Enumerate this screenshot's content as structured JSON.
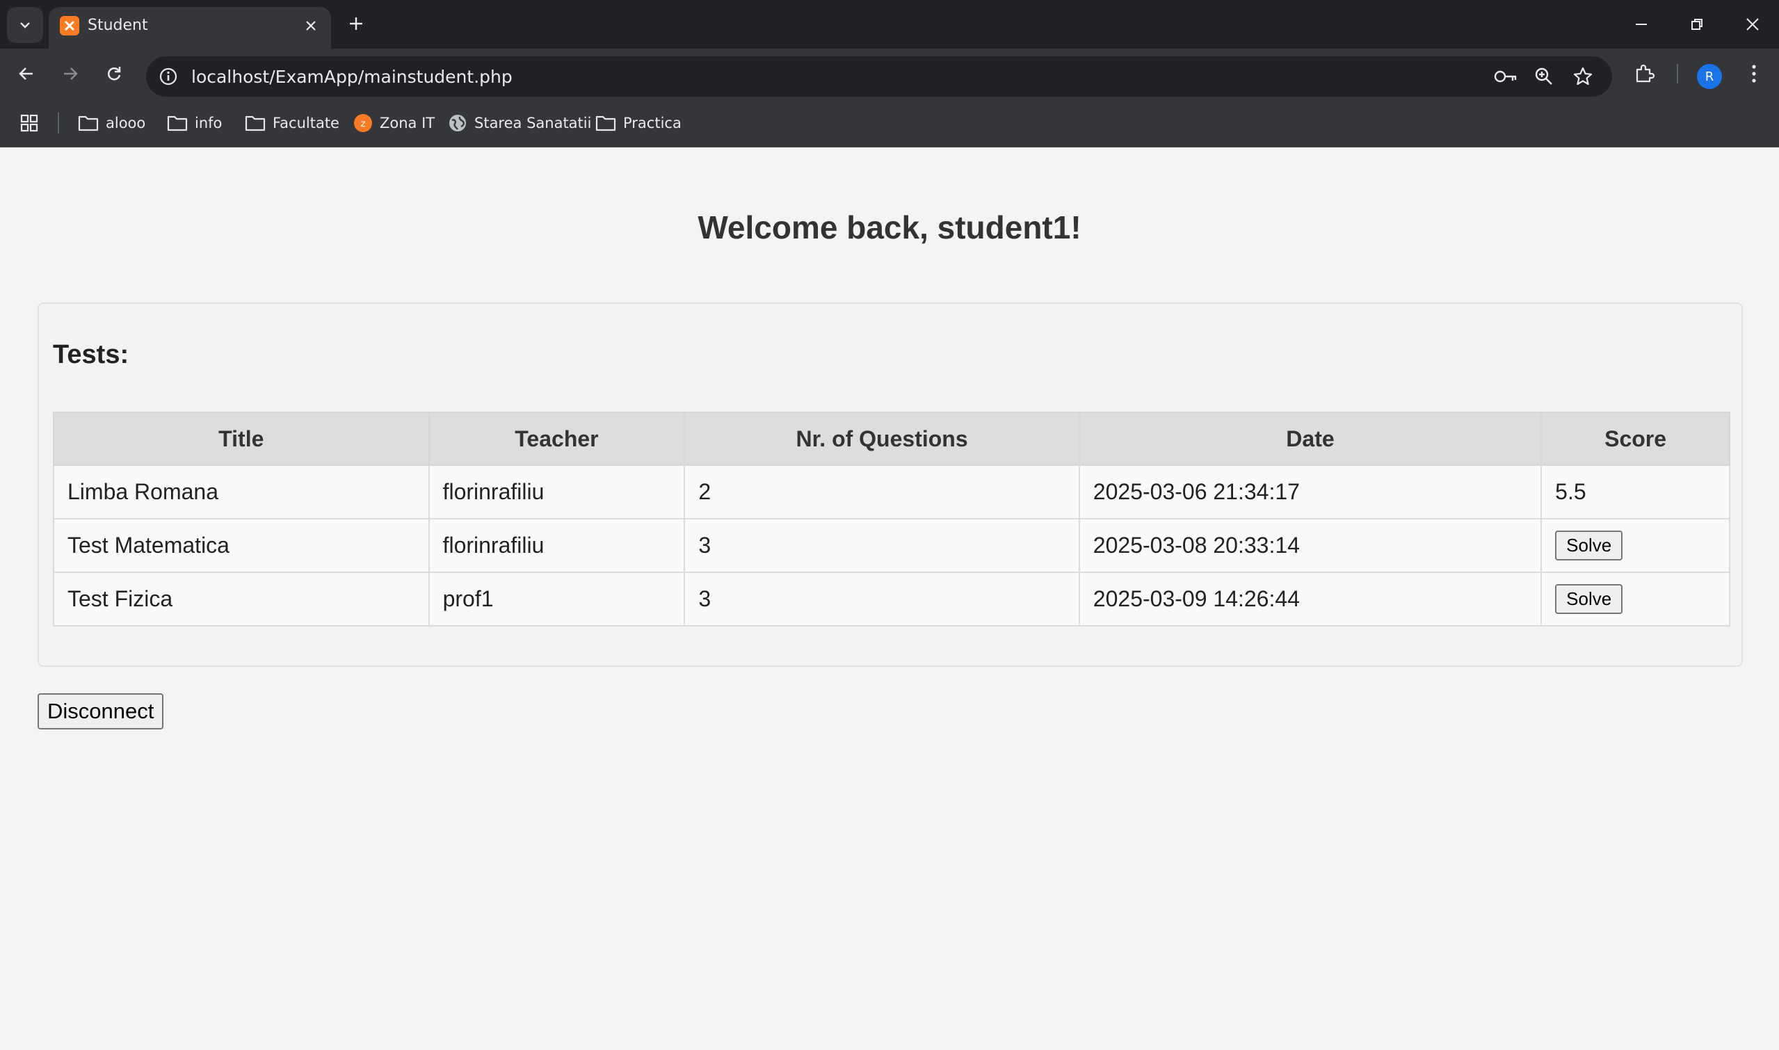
{
  "browser": {
    "tab_title": "Student",
    "url": "localhost/ExamApp/mainstudent.php",
    "avatar_letter": "R",
    "accent_color": "#1a73e8",
    "favicon_color": "#fb7a24",
    "bookmarks": [
      {
        "label": "alooo",
        "icon": "folder-icon"
      },
      {
        "label": "info",
        "icon": "folder-icon"
      },
      {
        "label": "Facultate",
        "icon": "folder-icon"
      },
      {
        "label": "Zona IT",
        "icon": "zona-it-icon"
      },
      {
        "label": "Starea Sanatatii",
        "icon": "globe-icon"
      },
      {
        "label": "Practica",
        "icon": "folder-icon"
      }
    ]
  },
  "page": {
    "welcome": "Welcome back, student1!",
    "tests_heading": "Tests:",
    "table": {
      "headers": [
        "Title",
        "Teacher",
        "Nr. of Questions",
        "Date",
        "Score"
      ],
      "rows": [
        {
          "title": "Limba Romana",
          "teacher": "florinrafiliu",
          "questions": "2",
          "date": "2025-03-06 21:34:17",
          "score": "5.5"
        },
        {
          "title": "Test Matematica",
          "teacher": "florinrafiliu",
          "questions": "3",
          "date": "2025-03-08 20:33:14",
          "score_button": "Solve"
        },
        {
          "title": "Test Fizica",
          "teacher": "prof1",
          "questions": "3",
          "date": "2025-03-09 14:26:44",
          "score_button": "Solve"
        }
      ]
    },
    "disconnect_label": "Disconnect"
  }
}
